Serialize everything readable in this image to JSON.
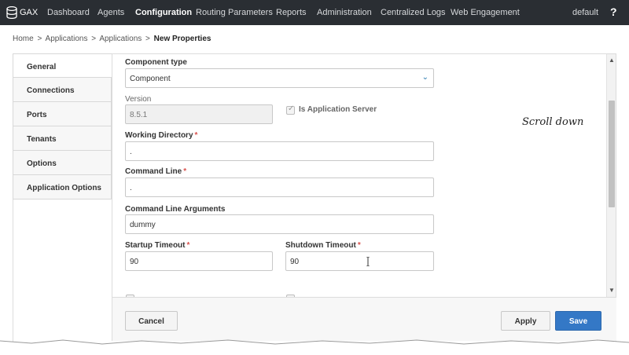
{
  "topbar": {
    "brand": "GAX",
    "nav": [
      "Dashboard",
      "Agents",
      "Configuration",
      "Routing Parameters",
      "Reports",
      "Administration",
      "Centralized Logs",
      "Web Engagement"
    ],
    "active": "Configuration",
    "user": "default",
    "help": "?"
  },
  "breadcrumb": {
    "items": [
      "Home",
      "Applications",
      "Applications"
    ],
    "separator": ">",
    "current": "New Properties"
  },
  "sidenav": {
    "items": [
      "General",
      "Connections",
      "Ports",
      "Tenants",
      "Options",
      "Application Options"
    ],
    "selected": "General"
  },
  "form": {
    "component_type": {
      "label": "Component type",
      "value": "Component"
    },
    "version": {
      "label": "Version",
      "value": "8.5.1"
    },
    "is_app_server": {
      "label": "Is Application Server",
      "checked": true
    },
    "working_dir": {
      "label": "Working Directory",
      "value": "."
    },
    "command_line": {
      "label": "Command Line",
      "value": "."
    },
    "cmd_args": {
      "label": "Command Line Arguments",
      "value": "dummy"
    },
    "startup_timeout": {
      "label": "Startup Timeout",
      "value": "90"
    },
    "shutdown_timeout": {
      "label": "Shutdown Timeout",
      "value": "90"
    },
    "required_mark": "*"
  },
  "annotation": "Scroll down",
  "footer": {
    "cancel": "Cancel",
    "apply": "Apply",
    "save": "Save"
  },
  "colors": {
    "topbar": "#2a2e33",
    "primary": "#3478c6",
    "required": "#d9534f"
  }
}
